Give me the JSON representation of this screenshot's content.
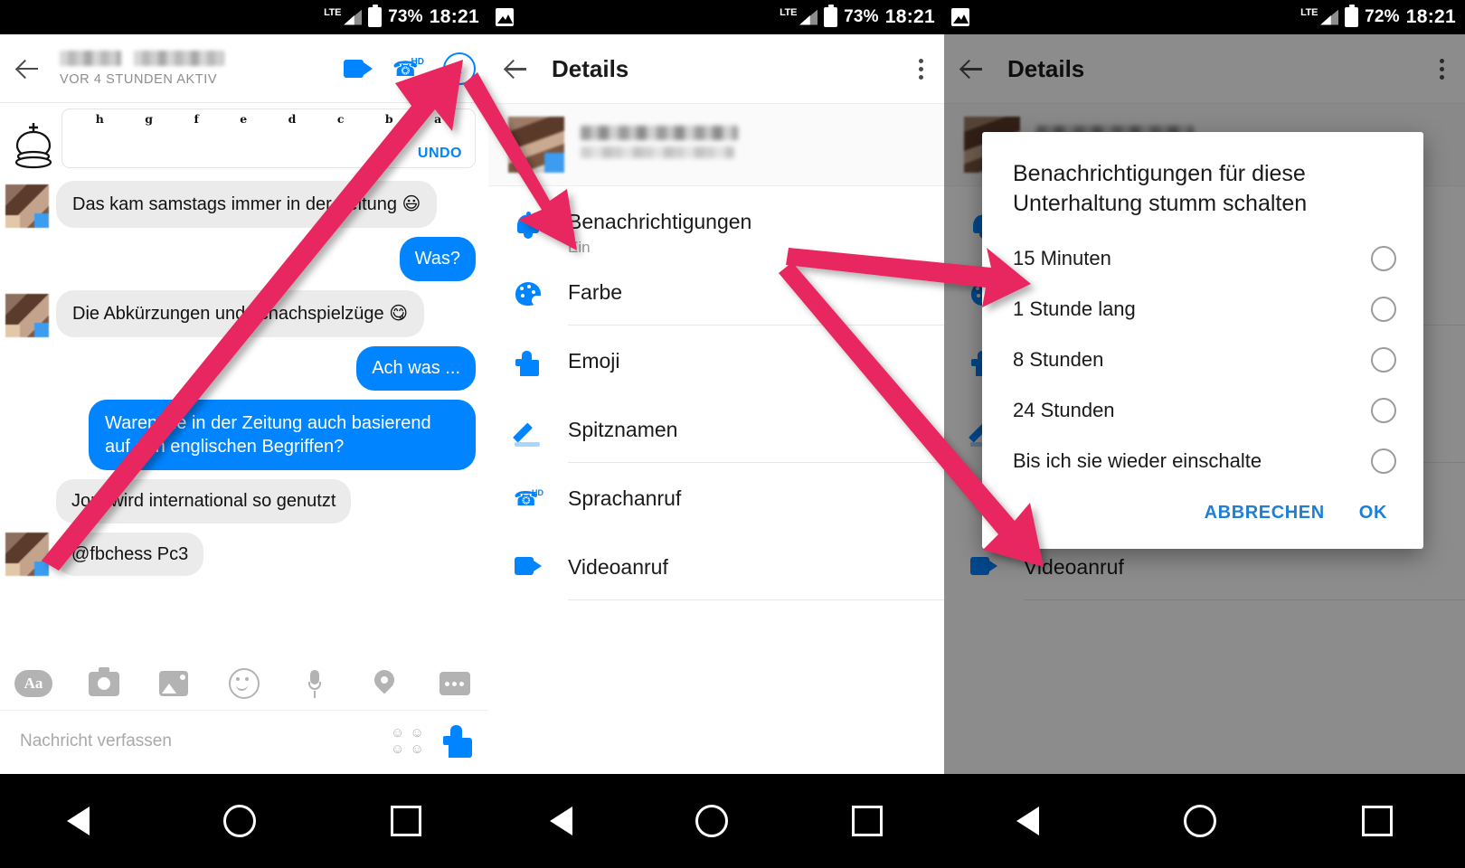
{
  "statusbars": [
    {
      "battery": "73%",
      "time": "18:21",
      "network": "LTE"
    },
    {
      "battery": "73%",
      "time": "18:21",
      "network": "LTE"
    },
    {
      "battery": "72%",
      "time": "18:21",
      "network": "LTE"
    }
  ],
  "chat": {
    "subtitle": "VOR 4 STUNDEN AKTIV",
    "chess": {
      "files": [
        "h",
        "g",
        "f",
        "e",
        "d",
        "c",
        "b",
        "a"
      ],
      "undo_label": "UNDO"
    },
    "messages": [
      {
        "dir": "in",
        "text": "Das kam samstags immer in der Zeitung 😃",
        "avatar": true
      },
      {
        "dir": "out",
        "text": "Was?"
      },
      {
        "dir": "in",
        "text": "Die Abkürzungen und schachspielzüge 😋",
        "avatar": true
      },
      {
        "dir": "out",
        "text": "Ach was ..."
      },
      {
        "dir": "out",
        "text": "Waren die in der Zeitung auch basierend auf den englischen Begriffen?"
      },
      {
        "dir": "in",
        "text": "Jop, wird international so genutzt",
        "avatar": false
      },
      {
        "dir": "in",
        "text": "@fbchess Pc3",
        "avatar": true
      }
    ],
    "composer": {
      "placeholder": "Nachricht verfassen",
      "tools": [
        "text-format-icon",
        "camera-icon",
        "gallery-icon",
        "sticker-icon",
        "microphone-icon",
        "location-icon",
        "more-icon"
      ]
    }
  },
  "details": {
    "title": "Details",
    "items": [
      {
        "label": "Benachrichtigungen",
        "sub": "Ein",
        "icon": "bell-icon"
      },
      {
        "label": "Farbe",
        "sub": "",
        "icon": "palette-icon"
      },
      {
        "label": "Emoji",
        "sub": "",
        "icon": "thumbs-up-icon"
      },
      {
        "label": "Spitznamen",
        "sub": "",
        "icon": "pencil-icon"
      },
      {
        "label": "Sprachanruf",
        "sub": "",
        "icon": "phone-hd-icon"
      },
      {
        "label": "Videoanruf",
        "sub": "",
        "icon": "video-icon"
      }
    ]
  },
  "dialog": {
    "title": "Benachrichtigungen für diese Unterhaltung stumm schalten",
    "options": [
      "15 Minuten",
      "1 Stunde lang",
      "8 Stunden",
      "24 Stunden",
      "Bis ich sie wieder einschalte"
    ],
    "cancel_label": "ABBRECHEN",
    "ok_label": "OK"
  },
  "colors": {
    "accent": "#0084ff",
    "arrow": "#e8265e",
    "dialog_button": "#1e7fd4"
  }
}
